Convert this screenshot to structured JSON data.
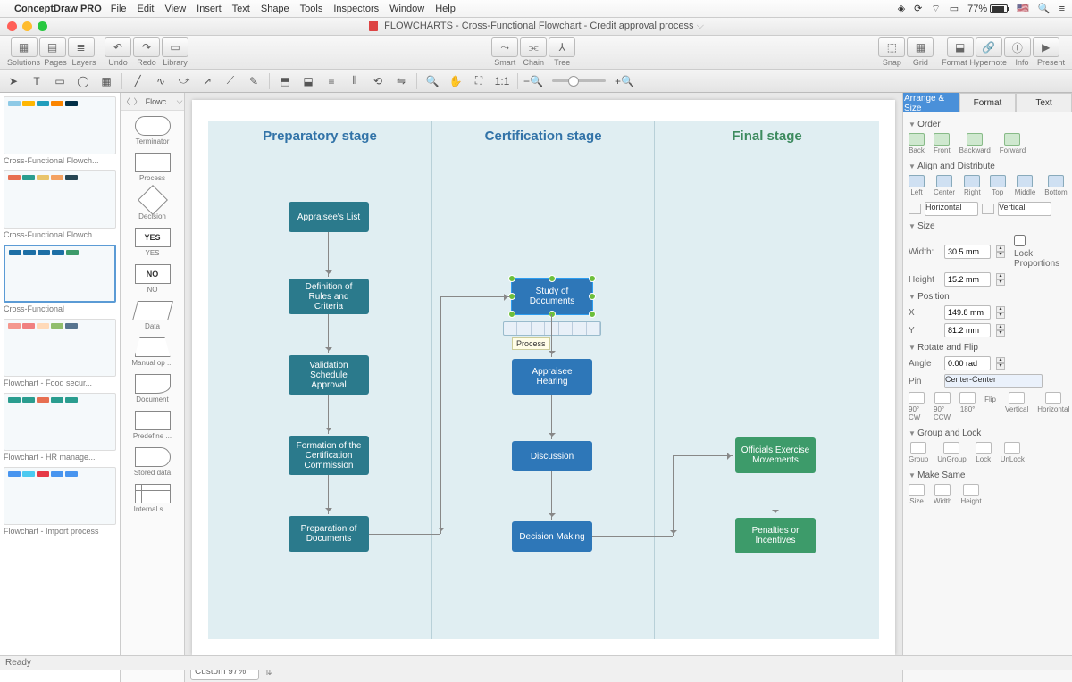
{
  "menubar": {
    "appname": "ConceptDraw PRO",
    "items": [
      "File",
      "Edit",
      "View",
      "Insert",
      "Text",
      "Shape",
      "Tools",
      "Inspectors",
      "Window",
      "Help"
    ],
    "battery_pct": "77%"
  },
  "titlebar": {
    "title": "FLOWCHARTS - Cross-Functional Flowchart - Credit approval process"
  },
  "toolbar1": {
    "left_labels": [
      "Solutions",
      "Pages",
      "Layers"
    ],
    "mid_labels": [
      "Undo",
      "Redo",
      "Library"
    ],
    "center_labels": [
      "Smart",
      "Chain",
      "Tree"
    ],
    "right1_labels": [
      "Snap",
      "Grid"
    ],
    "right2_labels": [
      "Format",
      "Hypernote",
      "Info",
      "Present"
    ]
  },
  "shapes_panel": {
    "header": "Flowc...",
    "items": [
      {
        "label": "Terminator",
        "cls": "shape-terminator"
      },
      {
        "label": "Process",
        "cls": ""
      },
      {
        "label": "Decision",
        "cls": "shape-decision"
      },
      {
        "label": "YES",
        "cls": "",
        "text": "YES"
      },
      {
        "label": "NO",
        "cls": "",
        "text": "NO"
      },
      {
        "label": "Data",
        "cls": "shape-data"
      },
      {
        "label": "Manual op ...",
        "cls": "shape-manual"
      },
      {
        "label": "Document",
        "cls": "shape-document"
      },
      {
        "label": "Predefine ...",
        "cls": "shape-predef"
      },
      {
        "label": "Stored data",
        "cls": "shape-stored"
      },
      {
        "label": "Internal s ...",
        "cls": "shape-internal"
      }
    ]
  },
  "docs": [
    {
      "label": "Cross-Functional Flowch...",
      "colors": [
        "#8ecae6",
        "#ffb703",
        "#219ebc",
        "#fb8500",
        "#023047"
      ]
    },
    {
      "label": "Cross-Functional Flowch...",
      "colors": [
        "#e76f51",
        "#2a9d8f",
        "#e9c46a",
        "#f4a261",
        "#264653"
      ]
    },
    {
      "label": "Cross-Functional",
      "colors": [
        "#1d6fa5",
        "#1d6fa5",
        "#1d6fa5",
        "#1d6fa5",
        "#3d9b6a"
      ],
      "selected": true
    },
    {
      "label": "Flowchart - Food secur...",
      "colors": [
        "#f4978e",
        "#f08080",
        "#ffdab9",
        "#90be6d",
        "#577590"
      ]
    },
    {
      "label": "Flowchart - HR manage...",
      "colors": [
        "#2a9d8f",
        "#2a9d8f",
        "#e76f51",
        "#2a9d8f",
        "#2a9d8f"
      ]
    },
    {
      "label": "Flowchart - Import process",
      "colors": [
        "#4895ef",
        "#4cc9f0",
        "#e63946",
        "#4895ef",
        "#4895ef"
      ]
    }
  ],
  "flow": {
    "lanes": [
      "Preparatory stage",
      "Certification stage",
      "Final stage"
    ],
    "boxes": {
      "b1": "Appraisee's List",
      "b2": "Definition of Rules and Criteria",
      "b3": "Validation Schedule Approval",
      "b4": "Formation of the Certification Commission",
      "b5": "Preparation of Documents",
      "c1": "Study of Documents",
      "c2": "Appraisee Hearing",
      "c3": "Discussion",
      "c4": "Decision Making",
      "f1": "Officials Exercise Movements",
      "f2": "Penalties or Incentives"
    },
    "tooltip": "Process"
  },
  "canvas_footer": {
    "zoom": "Custom 97%"
  },
  "inspector": {
    "tabs": [
      "Arrange & Size",
      "Format",
      "Text"
    ],
    "sections": {
      "order": {
        "title": "Order",
        "items": [
          "Back",
          "Front",
          "Backward",
          "Forward"
        ]
      },
      "align": {
        "title": "Align and Distribute",
        "items": [
          "Left",
          "Center",
          "Right",
          "Top",
          "Middle",
          "Bottom"
        ],
        "h": "Horizontal",
        "v": "Vertical"
      },
      "size": {
        "title": "Size",
        "width_lbl": "Width:",
        "width": "30.5 mm",
        "height_lbl": "Height",
        "height": "15.2 mm",
        "lock": "Lock Proportions"
      },
      "position": {
        "title": "Position",
        "x_lbl": "X",
        "x": "149.8 mm",
        "y_lbl": "Y",
        "y": "81.2 mm"
      },
      "rotate": {
        "title": "Rotate and Flip",
        "angle_lbl": "Angle",
        "angle": "0.00 rad",
        "pin_lbl": "Pin",
        "pin": "Center-Center",
        "items": [
          "90° CW",
          "90° CCW",
          "180°"
        ],
        "flip": "Flip",
        "flip_items": [
          "Vertical",
          "Horizontal"
        ]
      },
      "group": {
        "title": "Group and Lock",
        "items": [
          "Group",
          "UnGroup",
          "Lock",
          "UnLock"
        ]
      },
      "makesame": {
        "title": "Make Same",
        "items": [
          "Size",
          "Width",
          "Height"
        ]
      }
    }
  },
  "statusbar": {
    "text": "Ready"
  }
}
